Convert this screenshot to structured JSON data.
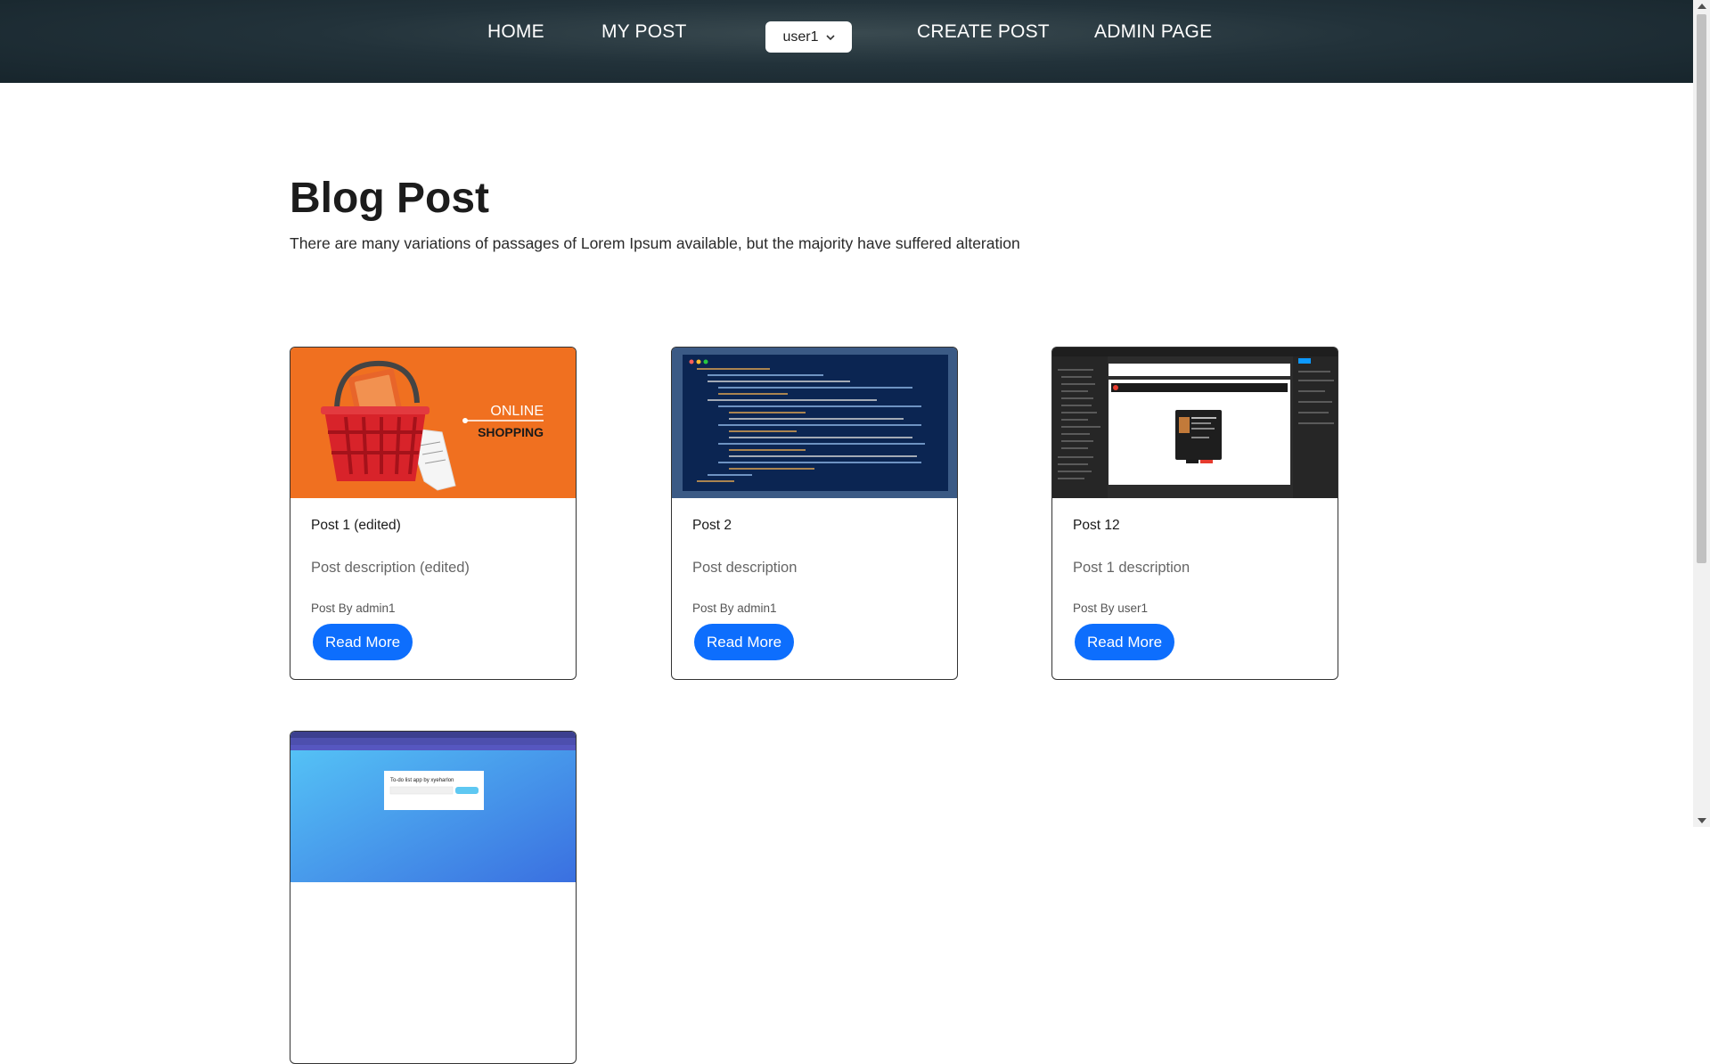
{
  "nav": {
    "home": "HOME",
    "my_post": "MY POST",
    "user": "user1",
    "create_post": "CREATE POST",
    "admin_page": "ADMIN PAGE"
  },
  "page": {
    "title": "Blog Post",
    "subtitle": "There are many variations of passages of Lorem Ipsum available, but the majority have suffered alteration"
  },
  "cards": [
    {
      "title": "Post 1 (edited)",
      "description": "Post description (edited)",
      "author": "Post By admin1",
      "button": "Read More",
      "image_text": [
        "ONLINE",
        "SHOPPING"
      ]
    },
    {
      "title": "Post 2",
      "description": "Post description",
      "author": "Post By admin1",
      "button": "Read More"
    },
    {
      "title": "Post 12",
      "description": "Post 1 description",
      "author": "Post By user1",
      "button": "Read More"
    },
    {
      "image_text": [
        "To-do list app by xyeharlon"
      ]
    }
  ],
  "colors": {
    "nav_bg": "#1e2d34",
    "button": "#0d6efd",
    "shopping_orange": "#f07020"
  }
}
